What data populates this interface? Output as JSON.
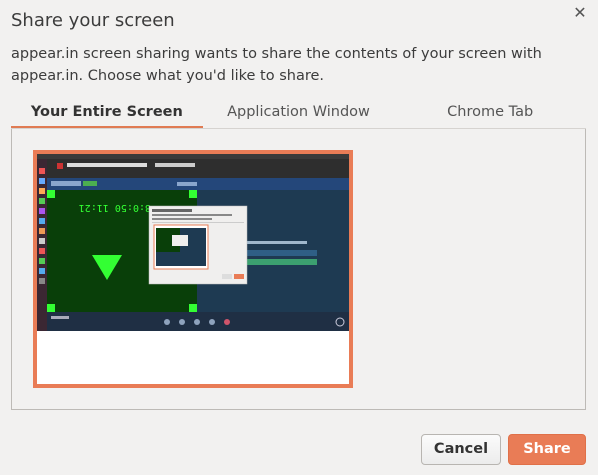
{
  "dialog": {
    "title": "Share your screen",
    "description": "appear.in screen sharing wants to share the contents of your screen with appear.in. Choose what you'd like to share.",
    "close_icon": "close-icon"
  },
  "tabs": [
    {
      "label": "Your Entire Screen",
      "active": true
    },
    {
      "label": "Application Window",
      "active": false
    },
    {
      "label": "Chrome Tab",
      "active": false
    }
  ],
  "preview": {
    "screen_text": "8:0:50 11:21"
  },
  "buttons": {
    "cancel_label": "Cancel",
    "share_label": "Share"
  },
  "colors": {
    "accent": "#e97c56",
    "background": "#f2f1f0"
  }
}
